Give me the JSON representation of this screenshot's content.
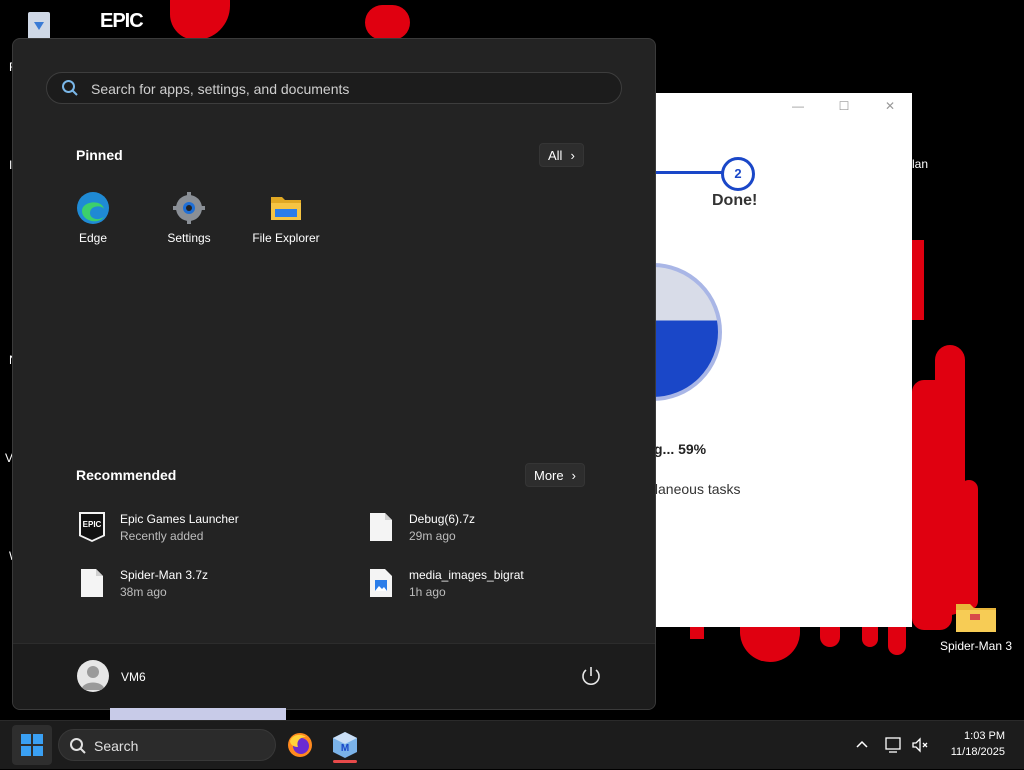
{
  "desktop": {
    "icons": [
      {
        "label": "Spider-Man 3"
      }
    ],
    "epic_logo": "EPIC",
    "edge_letters": [
      "R",
      "I",
      "N",
      "V",
      "W"
    ],
    "partial_label": "lan"
  },
  "installer": {
    "step_number": "2",
    "step_label": "Done!",
    "progress_text": "g... 59%",
    "progress_percent": 59,
    "task_text": "ellaneous tasks"
  },
  "start_menu": {
    "search_placeholder": "Search for apps, settings, and documents",
    "pinned_title": "Pinned",
    "all_button": "All",
    "pinned_apps": [
      {
        "label": "Edge",
        "icon": "edge-icon"
      },
      {
        "label": "Settings",
        "icon": "settings-gear-icon"
      },
      {
        "label": "File Explorer",
        "icon": "folder-icon"
      }
    ],
    "recommended_title": "Recommended",
    "more_button": "More",
    "recommended": [
      {
        "name": "Epic Games Launcher",
        "sub": "Recently added",
        "icon": "epic-games-icon"
      },
      {
        "name": "Debug(6).7z",
        "sub": "29m ago",
        "icon": "file-icon"
      },
      {
        "name": "Spider-Man 3.7z",
        "sub": "38m ago",
        "icon": "file-icon"
      },
      {
        "name": "media_images_bigrat",
        "sub": "1h ago",
        "icon": "image-file-icon"
      }
    ],
    "user_name": "VM6"
  },
  "taskbar": {
    "search_label": "Search",
    "time": "1:03 PM",
    "date": "11/18/2025",
    "apps": [
      "firefox-icon",
      "installer-app-icon"
    ]
  },
  "colors": {
    "menu_bg": "#232323",
    "accent_blue": "#1a47c8",
    "bg_red": "#e00010"
  }
}
